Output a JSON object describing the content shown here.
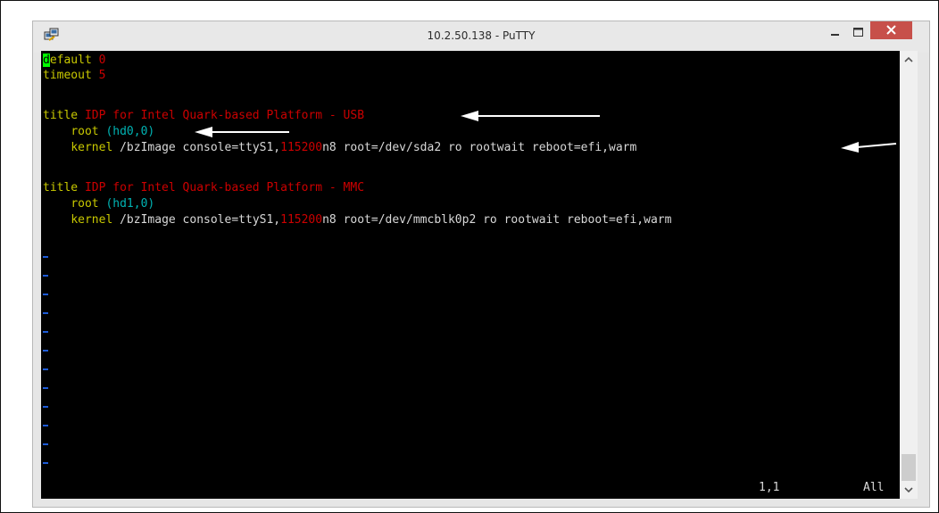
{
  "window": {
    "title": "10.2.50.138 - PuTTY",
    "app_icon": "putty-icon",
    "controls": {
      "minimize": "minimize-icon",
      "maximize": "maximize-icon",
      "close": "close-icon"
    }
  },
  "colors": {
    "keyword": "#c8c800",
    "value": "#cc0000",
    "device": "#00b3b3",
    "text": "#d8d8d8",
    "cursor": "#00ff00",
    "tilde": "#1e5bd6",
    "close_button": "#c7504a"
  },
  "editor": {
    "lines": [
      {
        "key": "default",
        "value": "0"
      },
      {
        "key": "timeout",
        "value": "5"
      },
      {
        "key": "title",
        "value": "IDP for Intel Quark-based Platform - USB"
      },
      {
        "key": "root",
        "value": "(hd0,0)"
      },
      {
        "key": "kernel",
        "cmd_a": "/bzImage console=ttyS1,",
        "baud": "115200",
        "cmd_b": "n8 root=/dev/sda2 ro rootwait reboot=efi,warm"
      },
      {
        "key": "title",
        "value": "IDP for Intel Quark-based Platform - MMC"
      },
      {
        "key": "root",
        "value": "(hd1,0)"
      },
      {
        "key": "kernel",
        "cmd_a": "/bzImage console=ttyS1,",
        "baud": "115200",
        "cmd_b": "n8 root=/dev/mmcblk0p2 ro rootwait reboot=efi,warm"
      }
    ],
    "cursor_char": "d",
    "default_rest": "efault",
    "tilde_char": "~"
  },
  "status": {
    "position": "1,1",
    "scroll": "All"
  },
  "annotations": [
    "arrow-icon",
    "arrow-icon",
    "arrow-icon"
  ]
}
